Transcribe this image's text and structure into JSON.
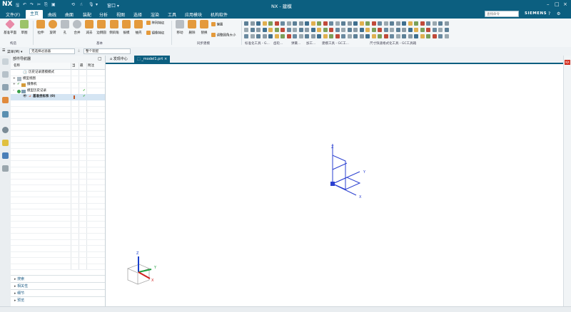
{
  "titlebar": {
    "app": "NX",
    "window_menu": "窗口 ▾",
    "window_title": "NX - 建模",
    "win_buttons": [
      "–",
      "□",
      "×"
    ]
  },
  "menu": {
    "items": [
      "文件(F)",
      "主页",
      "曲线",
      "曲面",
      "装配",
      "分析",
      "视图",
      "选择",
      "渲染",
      "工具",
      "应用模块",
      "机构软件"
    ],
    "active_index": 1,
    "search_placeholder": "查找命令",
    "brand": "SIEMENS"
  },
  "ribbon": {
    "buttons": [
      {
        "label": "基准平面",
        "icon": "datum-plane-icon",
        "color": "#e88aa8"
      },
      {
        "label": "草图",
        "icon": "sketch-icon",
        "color": "#9cc36a"
      },
      {
        "label": "拉伸",
        "icon": "extrude-icon",
        "color": "#e49a3c"
      },
      {
        "label": "旋转",
        "icon": "revolve-icon",
        "color": "#e49a3c"
      },
      {
        "label": "孔",
        "icon": "hole-icon",
        "color": "#b8bec4"
      },
      {
        "label": "合并",
        "icon": "unite-icon",
        "color": "#b8bec4"
      },
      {
        "label": "减去",
        "icon": "subtract-icon",
        "color": "#e49a3c"
      },
      {
        "label": "边倒圆",
        "icon": "edge-blend-icon",
        "color": "#e49a3c"
      },
      {
        "label": "倒斜角",
        "icon": "chamfer-icon",
        "color": "#e49a3c"
      },
      {
        "label": "拔模",
        "icon": "draft-icon",
        "color": "#e49a3c"
      },
      {
        "label": "抽壳",
        "icon": "shell-icon",
        "color": "#e49a3c"
      },
      {
        "label": "移动",
        "icon": "move-face-icon",
        "color": "#b8bec4"
      },
      {
        "label": "删除",
        "icon": "delete-face-icon",
        "color": "#e49a3c"
      },
      {
        "label": "替换",
        "icon": "replace-face-icon",
        "color": "#e49a3c"
      }
    ],
    "small_buttons": [
      {
        "label": "阵列特征",
        "icon": "pattern-feature-icon"
      },
      {
        "label": "镜像特征",
        "icon": "mirror-feature-icon"
      },
      {
        "label": "偏置",
        "icon": "offset-icon"
      },
      {
        "label": "调整圆角大小",
        "icon": "resize-blend-icon"
      }
    ],
    "groups": [
      "构造",
      "基本",
      "同步建模",
      "标准化工具 - G...",
      "齿轮...",
      "弹簧...",
      "加工...",
      "建模工具 - GC工...",
      "尺寸快速格式化工具 - GC工具箱"
    ]
  },
  "filterbar": {
    "menu_label": "菜单(M) ▾",
    "filter_value": "无选择过滤器",
    "scope_value": "整个装配"
  },
  "navigator": {
    "title": "部件导航器",
    "columns": [
      "名称",
      "当",
      "最",
      "附注"
    ],
    "rows": [
      {
        "label": "历史记录建模模式",
        "indent": 1,
        "icon": "clock-icon"
      },
      {
        "label": "模型视图",
        "indent": 0,
        "icon": "model-views-icon"
      },
      {
        "label": "摄像机",
        "indent": 0,
        "icon": "camera-icon"
      },
      {
        "label": "模型历史记录",
        "indent": 0,
        "icon": "model-history-icon"
      },
      {
        "label": "基准坐标系 (0)",
        "indent": 1,
        "icon": "datum-csys-icon"
      }
    ],
    "panels": [
      "搜索",
      "相关性",
      "细节",
      "预览"
    ]
  },
  "tabs": [
    {
      "label": "发现中心",
      "icon": "home-icon"
    },
    {
      "label": "_model1.prt",
      "icon": "part-icon"
    }
  ],
  "graphics": {
    "axis_labels": {
      "x": "X",
      "y": "Y",
      "z": "Z"
    },
    "colors": {
      "csys": "#2a3fd0",
      "triad_x": "#d02020",
      "triad_y": "#20a040",
      "triad_z": "#1a3fcc"
    }
  }
}
